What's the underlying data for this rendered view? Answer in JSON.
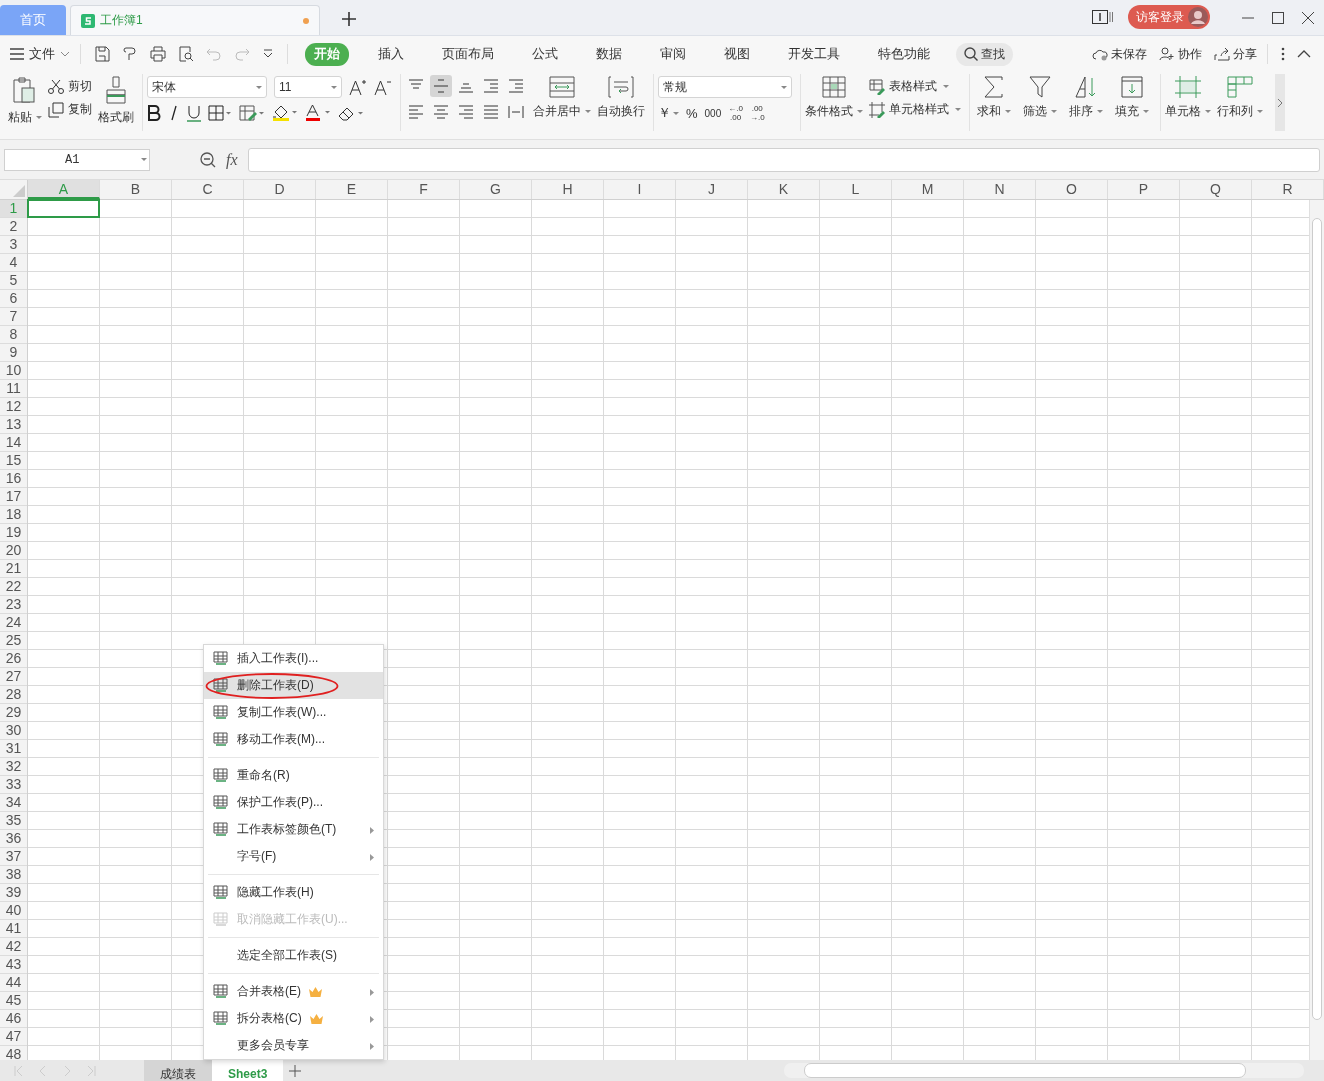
{
  "title_bar": {
    "tabs": [
      {
        "label": "首页",
        "kind": "home",
        "selected": false
      },
      {
        "label": "工作簿1",
        "kind": "document",
        "selected": true
      }
    ],
    "unsaved_dot": true,
    "login_button": "访客登录"
  },
  "menu_bar": {
    "file_menu": "文件",
    "tabs": [
      {
        "label": "开始",
        "selected": true
      },
      {
        "label": "插入",
        "selected": false
      },
      {
        "label": "页面布局",
        "selected": false
      },
      {
        "label": "公式",
        "selected": false
      },
      {
        "label": "数据",
        "selected": false
      },
      {
        "label": "审阅",
        "selected": false
      },
      {
        "label": "视图",
        "selected": false
      },
      {
        "label": "开发工具",
        "selected": false
      },
      {
        "label": "特色功能",
        "selected": false
      }
    ],
    "search": "查找",
    "actions": [
      {
        "label": "未保存",
        "kind": "cloud"
      },
      {
        "label": "协作",
        "kind": "person"
      },
      {
        "label": "分享",
        "kind": "share"
      }
    ]
  },
  "ribbon": {
    "paste": "粘贴",
    "cut": "剪切",
    "copy": "复制",
    "format_painter": "格式刷",
    "font_family": "宋体",
    "font_size": "11",
    "align_buttons": [
      {
        "selected": false
      },
      {
        "selected": true
      },
      {
        "selected": false
      },
      {
        "selected": false
      },
      {
        "selected": false
      },
      {
        "selected": false
      },
      {
        "selected": false
      },
      {
        "selected": false
      },
      {
        "selected": false
      },
      {
        "selected": false
      }
    ],
    "merge": "合并居中",
    "wrap": "自动换行",
    "number_format": "常规",
    "currency": "￥",
    "percent": "%",
    "thousands": "000",
    "decimals": [
      {
        "top": "←.0",
        "bottom": ".00"
      },
      {
        "top": ".00",
        "bottom": "→.0"
      }
    ],
    "conditional_format": "条件格式",
    "table_style": "表格样式",
    "cell_style": "单元格样式",
    "tools": [
      {
        "label": "求和",
        "kind": "sum"
      },
      {
        "label": "筛选",
        "kind": "filter"
      },
      {
        "label": "排序",
        "kind": "sort"
      },
      {
        "label": "填充",
        "kind": "fill"
      },
      {
        "label": "单元格",
        "kind": "cell"
      },
      {
        "label": "行和列",
        "kind": "rowcol"
      }
    ]
  },
  "formula_bar": {
    "name_box": "A1",
    "fx": "fx"
  },
  "sheet": {
    "columns": [
      {
        "label": "A",
        "selected": true
      },
      {
        "label": "B",
        "selected": false
      },
      {
        "label": "C",
        "selected": false
      },
      {
        "label": "D",
        "selected": false
      },
      {
        "label": "E",
        "selected": false
      },
      {
        "label": "F",
        "selected": false
      },
      {
        "label": "G",
        "selected": false
      },
      {
        "label": "H",
        "selected": false
      },
      {
        "label": "I",
        "selected": false
      },
      {
        "label": "J",
        "selected": false
      },
      {
        "label": "K",
        "selected": false
      },
      {
        "label": "L",
        "selected": false
      },
      {
        "label": "M",
        "selected": false
      },
      {
        "label": "N",
        "selected": false
      },
      {
        "label": "O",
        "selected": false
      },
      {
        "label": "P",
        "selected": false
      },
      {
        "label": "Q",
        "selected": false
      },
      {
        "label": "R",
        "selected": false
      }
    ],
    "rows": [
      {
        "label": "1",
        "selected": true
      },
      {
        "label": "2",
        "selected": false
      },
      {
        "label": "3",
        "selected": false
      },
      {
        "label": "4",
        "selected": false
      },
      {
        "label": "5",
        "selected": false
      },
      {
        "label": "6",
        "selected": false
      },
      {
        "label": "7",
        "selected": false
      },
      {
        "label": "8",
        "selected": false
      },
      {
        "label": "9",
        "selected": false
      },
      {
        "label": "10",
        "selected": false
      },
      {
        "label": "11",
        "selected": false
      },
      {
        "label": "12",
        "selected": false
      },
      {
        "label": "13",
        "selected": false
      },
      {
        "label": "14",
        "selected": false
      },
      {
        "label": "15",
        "selected": false
      },
      {
        "label": "16",
        "selected": false
      },
      {
        "label": "17",
        "selected": false
      },
      {
        "label": "18",
        "selected": false
      },
      {
        "label": "19",
        "selected": false
      },
      {
        "label": "20",
        "selected": false
      },
      {
        "label": "21",
        "selected": false
      },
      {
        "label": "22",
        "selected": false
      },
      {
        "label": "23",
        "selected": false
      },
      {
        "label": "24",
        "selected": false
      },
      {
        "label": "25",
        "selected": false
      },
      {
        "label": "26",
        "selected": false
      },
      {
        "label": "27",
        "selected": false
      },
      {
        "label": "28",
        "selected": false
      },
      {
        "label": "29",
        "selected": false
      },
      {
        "label": "30",
        "selected": false
      },
      {
        "label": "31",
        "selected": false
      },
      {
        "label": "32",
        "selected": false
      },
      {
        "label": "33",
        "selected": false
      },
      {
        "label": "34",
        "selected": false
      },
      {
        "label": "35",
        "selected": false
      },
      {
        "label": "36",
        "selected": false
      },
      {
        "label": "37",
        "selected": false
      },
      {
        "label": "38",
        "selected": false
      },
      {
        "label": "39",
        "selected": false
      },
      {
        "label": "40",
        "selected": false
      },
      {
        "label": "41",
        "selected": false
      },
      {
        "label": "42",
        "selected": false
      },
      {
        "label": "43",
        "selected": false
      },
      {
        "label": "44",
        "selected": false
      },
      {
        "label": "45",
        "selected": false
      },
      {
        "label": "46",
        "selected": false
      },
      {
        "label": "47",
        "selected": false
      },
      {
        "label": "48",
        "selected": false
      }
    ]
  },
  "sheet_tabs": [
    {
      "label": "成绩表",
      "selected": false
    },
    {
      "label": "Sheet3",
      "selected": true
    }
  ],
  "context_menu": {
    "groups": [
      [
        {
          "label": "插入工作表(I)...",
          "icon": true,
          "selected": false,
          "disabled": false,
          "submenu": false,
          "premium": false,
          "circled": false
        },
        {
          "label": "删除工作表(D)",
          "icon": true,
          "selected": true,
          "disabled": false,
          "submenu": false,
          "premium": false,
          "circled": true
        },
        {
          "label": "复制工作表(W)...",
          "icon": true,
          "selected": false,
          "disabled": false,
          "submenu": false,
          "premium": false,
          "circled": false
        },
        {
          "label": "移动工作表(M)...",
          "icon": true,
          "selected": false,
          "disabled": false,
          "submenu": false,
          "premium": false,
          "circled": false
        }
      ],
      [
        {
          "label": "重命名(R)",
          "icon": true,
          "selected": false,
          "disabled": false,
          "submenu": false,
          "premium": false,
          "circled": false
        },
        {
          "label": "保护工作表(P)...",
          "icon": true,
          "selected": false,
          "disabled": false,
          "submenu": false,
          "premium": false,
          "circled": false
        },
        {
          "label": "工作表标签颜色(T)",
          "icon": true,
          "selected": false,
          "disabled": false,
          "submenu": true,
          "premium": false,
          "circled": false
        },
        {
          "label": "字号(F)",
          "icon": false,
          "selected": false,
          "disabled": false,
          "submenu": true,
          "premium": false,
          "circled": false
        }
      ],
      [
        {
          "label": "隐藏工作表(H)",
          "icon": true,
          "selected": false,
          "disabled": false,
          "submenu": false,
          "premium": false,
          "circled": false
        },
        {
          "label": "取消隐藏工作表(U)...",
          "icon": true,
          "selected": false,
          "disabled": true,
          "submenu": false,
          "premium": false,
          "circled": false
        }
      ],
      [
        {
          "label": "选定全部工作表(S)",
          "icon": false,
          "selected": false,
          "disabled": false,
          "submenu": false,
          "premium": false,
          "circled": false
        }
      ],
      [
        {
          "label": "合并表格(E)",
          "icon": true,
          "selected": false,
          "disabled": false,
          "submenu": true,
          "premium": true,
          "circled": false
        },
        {
          "label": "拆分表格(C)",
          "icon": true,
          "selected": false,
          "disabled": false,
          "submenu": true,
          "premium": true,
          "circled": false
        },
        {
          "label": "更多会员专享",
          "icon": false,
          "selected": false,
          "disabled": false,
          "submenu": true,
          "premium": false,
          "circled": false
        }
      ]
    ]
  }
}
